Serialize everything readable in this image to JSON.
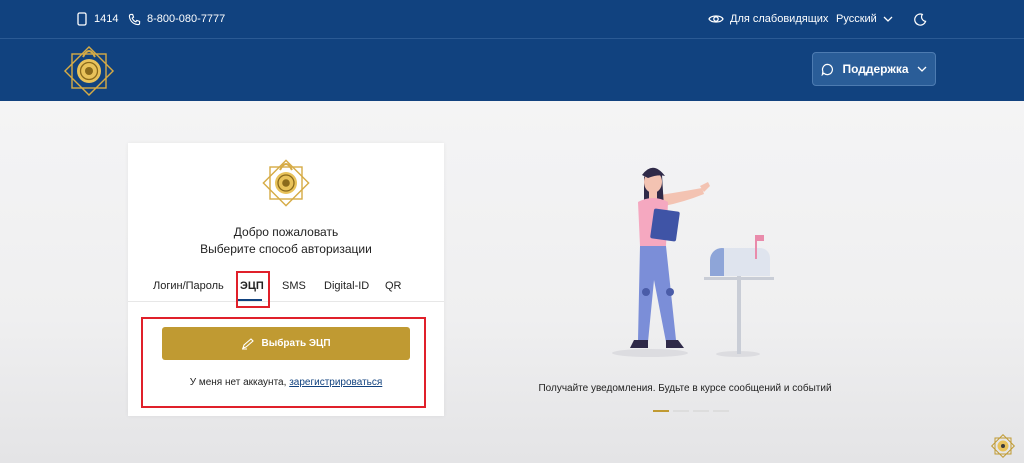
{
  "topbar": {
    "short_number": "1414",
    "phone": "8-800-080-7777",
    "accessibility_label": "Для слабовидящих",
    "language": "Русский"
  },
  "navbar": {
    "support_label": "Поддержка"
  },
  "login": {
    "welcome": "Добро пожаловать",
    "subtitle": "Выберите способ авторизации",
    "tabs": [
      {
        "label": "Логин/Пароль"
      },
      {
        "label": "ЭЦП"
      },
      {
        "label": "SMS"
      },
      {
        "label": "Digital-ID"
      },
      {
        "label": "QR"
      }
    ],
    "active_tab": "ЭЦП",
    "select_button_label": "Выбрать ЭЦП",
    "no_account_text": "У меня нет аккаунта,",
    "register_link": "зарегистрироваться"
  },
  "promo": {
    "caption": "Получайте уведомления. Будьте в курсе сообщений и событий",
    "slides_count": 4,
    "active_slide": 1
  },
  "colors": {
    "brand_blue": "#11427f",
    "gold": "#c09a32",
    "highlight_red": "#e0202a"
  }
}
